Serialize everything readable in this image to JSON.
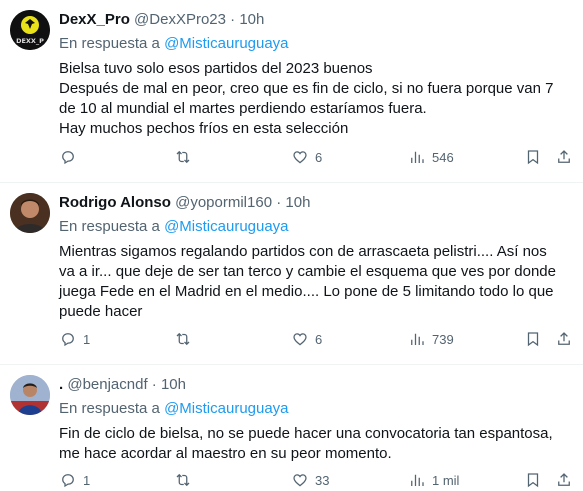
{
  "tweets": [
    {
      "name": "DexX_Pro",
      "handle": "@DexXPro23",
      "dot": "·",
      "time": "10h",
      "reply_prefix": "En respuesta a",
      "reply_to": "@Misticauruguaya",
      "lines": [
        "Bielsa tuvo solo esos partidos del 2023 buenos",
        "Después de mal en peor, creo que es fin de ciclo, si no fuera porque van 7",
        "de 10 al mundial el martes perdiendo estaríamos fuera.",
        "Hay muchos pechos fríos en esta selección"
      ],
      "avatar_text": "DEXX_P",
      "reply_count": "",
      "retweet_count": "",
      "like_count": "6",
      "view_count": "546"
    },
    {
      "name": "Rodrigo Alonso",
      "handle": "@yopormil160",
      "dot": "·",
      "time": "10h",
      "reply_prefix": "En respuesta a",
      "reply_to": "@Misticauruguaya",
      "lines": [
        "Mientras sigamos regalando partidos con de arrascaeta pelistri.... Así nos",
        "va a ir... que deje de ser tan terco y cambie el esquema que ves por donde",
        "juega Fede en el Madrid en el medio.... Lo pone de 5 limitando todo lo que",
        "puede hacer"
      ],
      "avatar_text": "",
      "reply_count": "1",
      "retweet_count": "",
      "like_count": "6",
      "view_count": "739"
    },
    {
      "name": ".",
      "handle": "@benjacndf",
      "dot": "·",
      "time": "10h",
      "reply_prefix": "En respuesta a",
      "reply_to": "@Misticauruguaya",
      "lines": [
        "Fin de ciclo de bielsa, no se puede hacer una convocatoria tan espantosa,",
        "me hace acordar al maestro en su peor momento."
      ],
      "avatar_text": "",
      "reply_count": "1",
      "retweet_count": "",
      "like_count": "33",
      "view_count": "1 mil"
    }
  ],
  "colors": {
    "text": "#0f1419",
    "secondary": "#536471",
    "link": "#1d9bf0",
    "divider": "#eff3f4"
  },
  "icons": [
    "reply-icon",
    "retweet-icon",
    "like-icon",
    "views-icon",
    "bookmark-icon",
    "share-icon"
  ]
}
